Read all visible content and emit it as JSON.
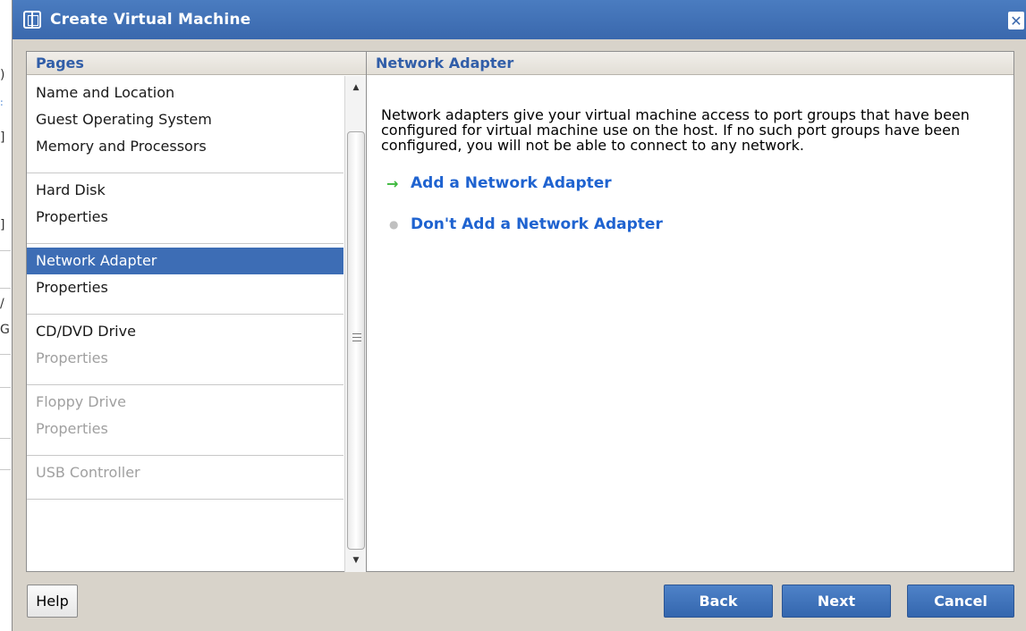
{
  "background_app": {
    "fragments": [
      ")",
      ":",
      "]",
      "]",
      "/",
      "G"
    ]
  },
  "dialog": {
    "title": "Create Virtual Machine",
    "close_label": "✕"
  },
  "pages_panel": {
    "header": "Pages",
    "groups": [
      {
        "items": [
          {
            "label": "Name and Location",
            "state": "normal"
          },
          {
            "label": "Guest Operating System",
            "state": "normal"
          },
          {
            "label": "Memory and Processors",
            "state": "normal"
          }
        ]
      },
      {
        "items": [
          {
            "label": "Hard Disk",
            "state": "normal"
          },
          {
            "label": "Properties",
            "state": "normal"
          }
        ]
      },
      {
        "items": [
          {
            "label": "Network Adapter",
            "state": "selected"
          },
          {
            "label": "Properties",
            "state": "normal"
          }
        ]
      },
      {
        "items": [
          {
            "label": "CD/DVD Drive",
            "state": "normal"
          },
          {
            "label": "Properties",
            "state": "disabled"
          }
        ]
      },
      {
        "items": [
          {
            "label": "Floppy Drive",
            "state": "disabled"
          },
          {
            "label": "Properties",
            "state": "disabled"
          }
        ]
      },
      {
        "items": [
          {
            "label": "USB Controller",
            "state": "disabled"
          }
        ]
      }
    ]
  },
  "content_panel": {
    "header": "Network Adapter",
    "description": "Network adapters give your virtual machine access to port groups that have been configured for virtual machine use on the host. If no such port groups have been configured, you will not be able to connect to any network.",
    "options": [
      {
        "label": "Add a Network Adapter",
        "marker": "→",
        "marker_icon": "arrow-right-icon",
        "marker_color": "#3cb83c"
      },
      {
        "label": "Don't Add a Network Adapter",
        "marker": "●",
        "marker_icon": "bullet-icon",
        "marker_color": "#c0c0c0"
      }
    ]
  },
  "buttons": {
    "help": "Help",
    "back": "Back",
    "next": "Next",
    "cancel": "Cancel"
  },
  "colors": {
    "titlebar": "#3a68ad",
    "dialog_bg": "#d8d3ca",
    "header_text": "#315ea8",
    "selected_row": "#3d6db5",
    "link": "#1f63d0"
  }
}
